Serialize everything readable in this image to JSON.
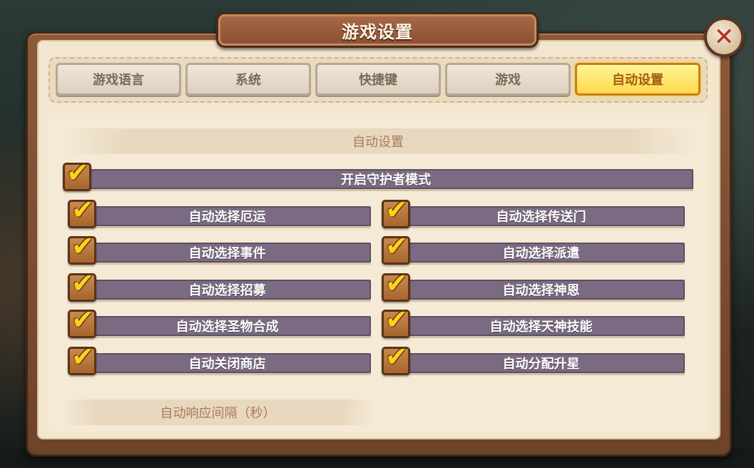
{
  "window": {
    "title": "游戏设置"
  },
  "tabs": [
    {
      "label": "游戏语言",
      "active": false
    },
    {
      "label": "系统",
      "active": false
    },
    {
      "label": "快捷键",
      "active": false
    },
    {
      "label": "游戏",
      "active": false
    },
    {
      "label": "自动设置",
      "active": true
    }
  ],
  "auto_section": {
    "header": "自动设置",
    "guardian_mode": {
      "label": "开启守护者模式",
      "checked": true
    },
    "left_options": [
      {
        "label": "自动选择厄运",
        "checked": true
      },
      {
        "label": "自动选择事件",
        "checked": true
      },
      {
        "label": "自动选择招募",
        "checked": true
      },
      {
        "label": "自动选择圣物合成",
        "checked": true
      },
      {
        "label": "自动关闭商店",
        "checked": true
      }
    ],
    "right_options": [
      {
        "label": "自动选择传送门",
        "checked": true
      },
      {
        "label": "自动选择派遣",
        "checked": true
      },
      {
        "label": "自动选择神恩",
        "checked": true
      },
      {
        "label": "自动选择天神技能",
        "checked": true
      },
      {
        "label": "自动分配升星",
        "checked": true
      }
    ]
  },
  "interval_section": {
    "header": "自动响应间隔（秒）"
  },
  "icons": {
    "close": "close-icon",
    "check": "checkmark-icon"
  },
  "colors": {
    "active_tab": "#ffd84a",
    "option_bar": "#7a6b82",
    "check": "#ffd21a",
    "close_x": "#b22f22"
  }
}
